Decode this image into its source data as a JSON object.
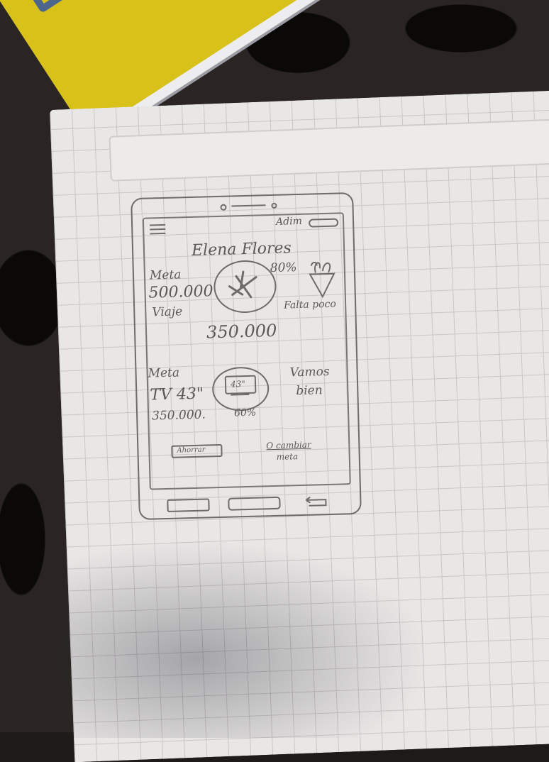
{
  "sketch": {
    "top_right_label": "Adim",
    "user_name": "Elena Flores",
    "goal1": {
      "goal_label": "Meta",
      "goal_amount": "500.000",
      "goal_name": "Viaje",
      "percent": "80%",
      "status": "Falta poco",
      "saved_amount": "350.000",
      "icon": "airplane-icon"
    },
    "goal2": {
      "goal_label": "Meta",
      "goal_name": "TV 43\"",
      "tv_size": "43\"",
      "goal_amount": "350.000.",
      "percent": "60%",
      "status_line1": "Vamos",
      "status_line2": "bien",
      "icon": "tv-icon"
    },
    "left_button_label": "Ahorrar",
    "right_link_line1": "O cambiar",
    "right_link_line2": "meta"
  }
}
